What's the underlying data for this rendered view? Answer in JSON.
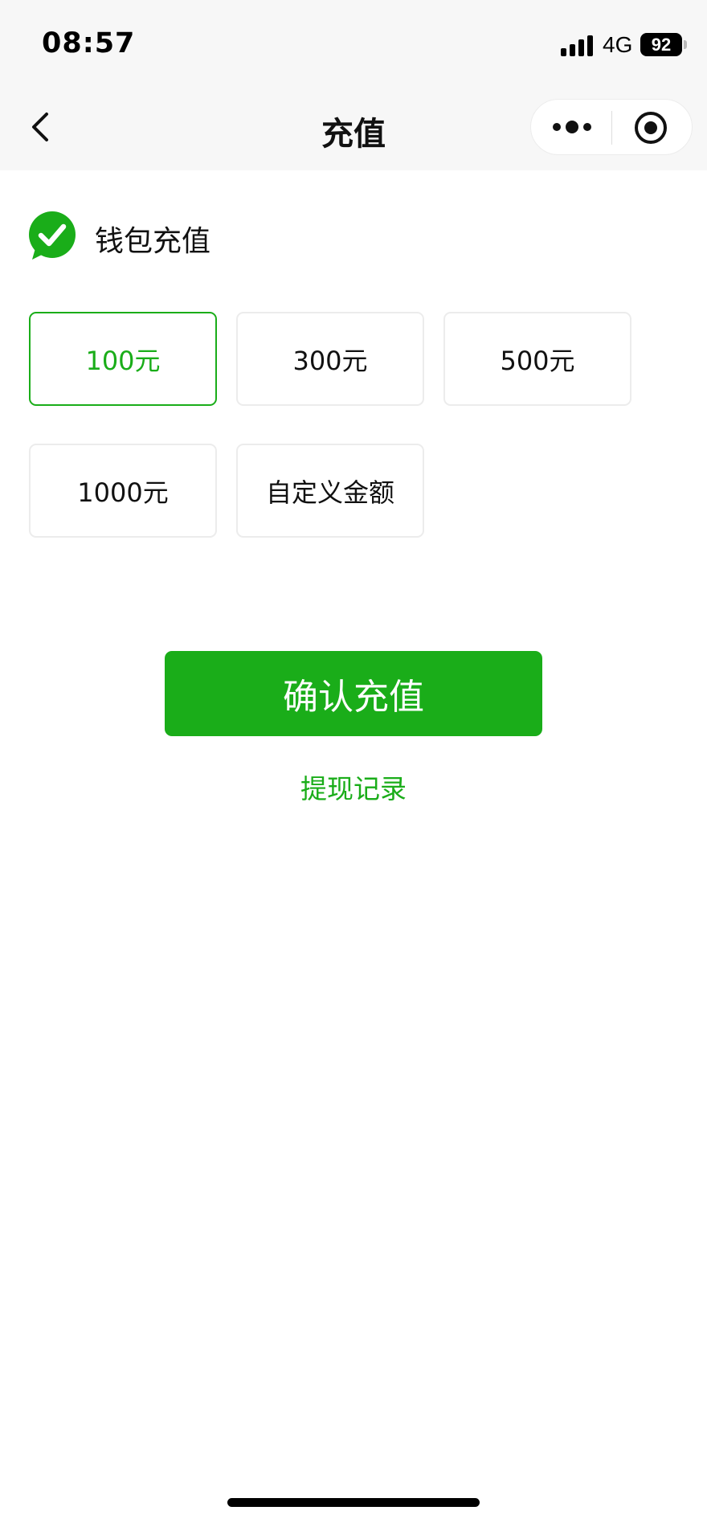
{
  "status_bar": {
    "time": "08:57",
    "network": "4G",
    "battery": "92"
  },
  "nav": {
    "title": "充值",
    "icons": {
      "back": "chevron-left-icon",
      "more": "more-dots-icon",
      "close": "target-close-icon"
    }
  },
  "wallet": {
    "title": "钱包充值",
    "icon": "wechat-pay-check-icon"
  },
  "amounts": {
    "options": [
      "100元",
      "300元",
      "500元",
      "1000元",
      "自定义金额"
    ],
    "selected_index": 0
  },
  "actions": {
    "confirm_label": "确认充值",
    "withdraw_label": "提现记录"
  },
  "colors": {
    "accent": "#1aad19",
    "nav_background": "#f7f7f7",
    "option_border": "#ececec"
  }
}
